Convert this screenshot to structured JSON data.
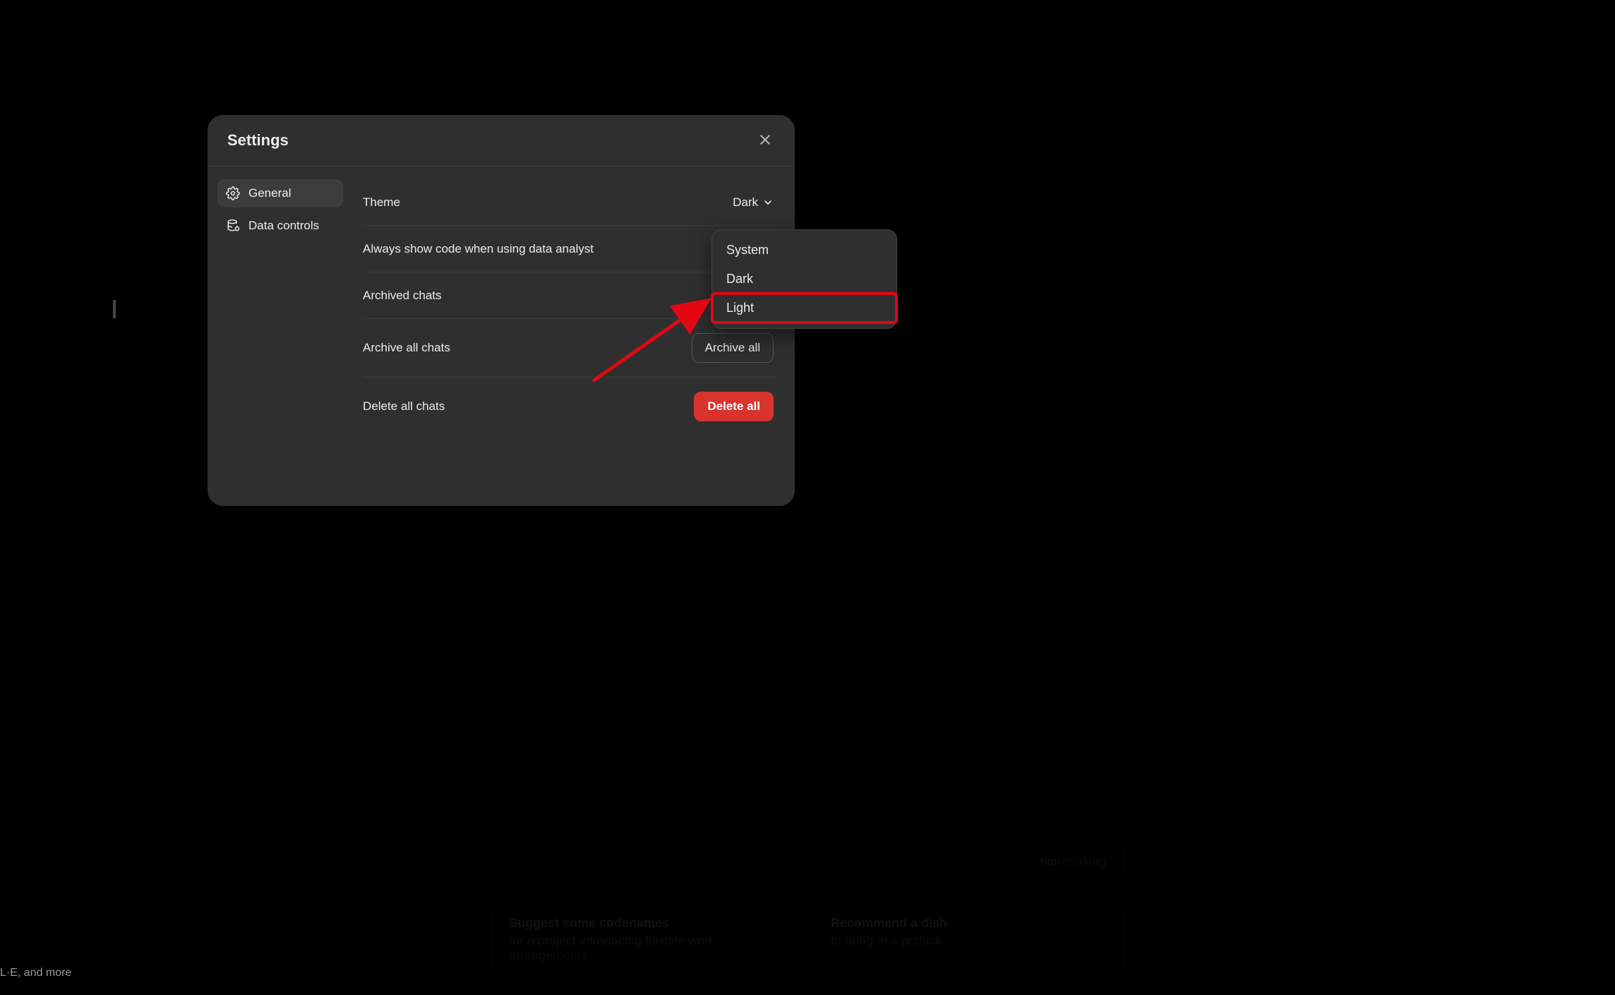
{
  "modal": {
    "title": "Settings",
    "sidebar": {
      "items": [
        {
          "label": "General",
          "active": true
        },
        {
          "label": "Data controls",
          "active": false
        }
      ]
    },
    "rows": {
      "theme": {
        "label": "Theme",
        "value": "Dark"
      },
      "always_code": {
        "label": "Always show code when using data analyst"
      },
      "archived": {
        "label": "Archived chats"
      },
      "archive_all": {
        "label": "Archive all chats",
        "button": "Archive all"
      },
      "delete_all": {
        "label": "Delete all chats",
        "button": "Delete all"
      }
    }
  },
  "dropdown": {
    "items": [
      "System",
      "Dark",
      "Light"
    ],
    "highlighted_index": 2
  },
  "background": {
    "hint": "L·E, and more",
    "cards": [
      {
        "title": "Suggest some codenames",
        "sub": "for a project introducing flexible work arrangements"
      },
      {
        "title": "Recommend a dish",
        "sub": "to bring to a potluck"
      }
    ],
    "partial_right": "tion-making"
  }
}
